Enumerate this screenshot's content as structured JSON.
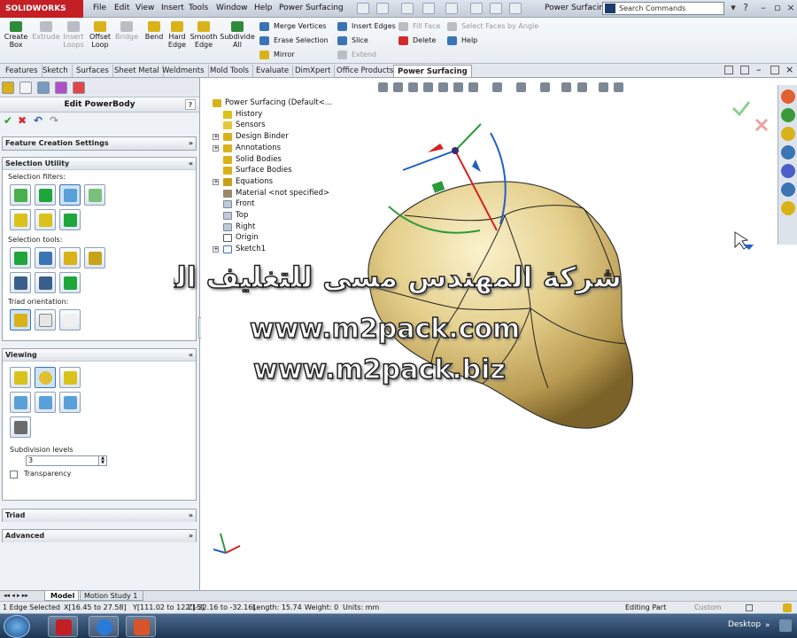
{
  "titlebar": {
    "logo": "SOLIDWORKS",
    "menus": [
      "File",
      "Edit",
      "View",
      "Insert",
      "Tools",
      "Window",
      "Help",
      "Power Surfacing"
    ],
    "doc_title": "Power Surfacin...",
    "search_placeholder": "Search Commands"
  },
  "ribbon": {
    "large": [
      {
        "label": "Create\nBox",
        "dim": false,
        "color": "#2e8b3a"
      },
      {
        "label": "Extrude",
        "dim": true,
        "color": "#b9bec6"
      },
      {
        "label": "Insert\nLoops",
        "dim": true,
        "color": "#b9bec6"
      },
      {
        "label": "Offset\nLoop",
        "dim": false,
        "color": "#d9b21a"
      },
      {
        "label": "Bridge",
        "dim": true,
        "color": "#b9bec6"
      },
      {
        "label": "Bend",
        "dim": false,
        "color": "#d9b21a"
      },
      {
        "label": "Hard\nEdge",
        "dim": false,
        "color": "#d9b21a"
      },
      {
        "label": "Smooth\nEdge",
        "dim": false,
        "color": "#d9b21a"
      },
      {
        "label": "Subdivide\nAll",
        "dim": false,
        "color": "#2e8b3a"
      }
    ],
    "small": [
      {
        "label": "Merge Vertices",
        "dim": false,
        "color": "#3a74b5"
      },
      {
        "label": "Erase Selection",
        "dim": false,
        "color": "#3a74b5"
      },
      {
        "label": "Mirror",
        "dim": false,
        "color": "#d9b21a"
      },
      {
        "label": "Insert Edges",
        "dim": false,
        "color": "#3a74b5"
      },
      {
        "label": "Slice",
        "dim": false,
        "color": "#3a74b5"
      },
      {
        "label": "Extend",
        "dim": true,
        "color": "#b9bec6"
      },
      {
        "label": "Fill Face",
        "dim": true,
        "color": "#b9bec6"
      },
      {
        "label": "Delete",
        "dim": false,
        "color": "#d42a2a"
      },
      {
        "label": "Select Faces by Angle",
        "dim": true,
        "color": "#b9bec6"
      },
      {
        "label": "Help",
        "dim": false,
        "color": "#3a74b5"
      }
    ]
  },
  "tabs": [
    "Features",
    "Sketch",
    "Surfaces",
    "Sheet Metal",
    "Weldments",
    "Mold Tools",
    "Evaluate",
    "DimXpert",
    "Office Products",
    "Power Surfacing"
  ],
  "active_tab": "Power Surfacing",
  "property_manager": {
    "title": "Edit PowerBody",
    "help": "?",
    "feature_creation": "Feature Creation Settings",
    "selection_utility": "Selection Utility",
    "selection_filters": "Selection filters:",
    "selection_tools": "Selection tools:",
    "triad_orientation": "Triad orientation:",
    "viewing": "Viewing",
    "subdivision_label": "Subdivision levels",
    "subdivision_value": "3",
    "transparency": "Transparency",
    "triad": "Triad",
    "advanced": "Advanced"
  },
  "tree": {
    "root": "Power Surfacing  (Default<...",
    "items": [
      "History",
      "Sensors",
      "Design Binder",
      "Annotations",
      "Solid Bodies",
      "Surface Bodies",
      "Equations",
      "Material <not specified>",
      "Front",
      "Top",
      "Right",
      "Origin",
      "Sketch1"
    ]
  },
  "watermark": {
    "arabic": "شركة المهندس مسى للتغليف الحديث",
    "url1": "www.m2pack.com",
    "url2": "www.m2pack.biz"
  },
  "bottom_tabs": [
    "Model",
    "Motion Study 1"
  ],
  "status": {
    "selection": "1 Edge Selected",
    "x": "X[16.45 to 27.58]",
    "y": "Y[111.02 to 122.15]",
    "z": "Z[-32.16 to -32.16]",
    "length": "Length: 15.74",
    "weight": "Weight: 0",
    "units": "Units: mm",
    "mode": "Editing Part",
    "custom": "Custom"
  },
  "taskbar": {
    "desktop": "Desktop"
  }
}
